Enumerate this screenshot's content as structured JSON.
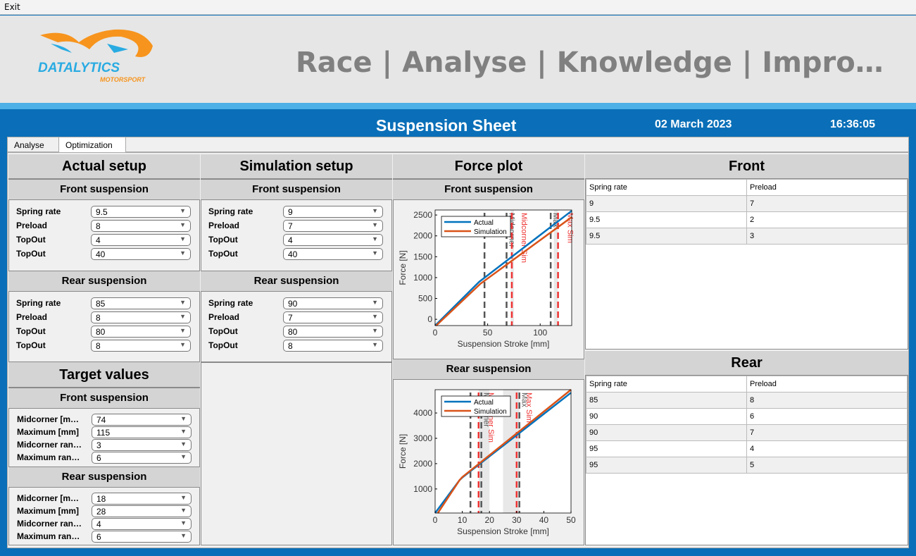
{
  "menu": {
    "exit": "Exit"
  },
  "banner": {
    "logo_text": "DATALYTICS",
    "logo_sub": "MOTORSPORT",
    "slogan": "Race | Analyse | Knowledge | Impro…"
  },
  "header": {
    "title": "Suspension Sheet",
    "date": "02 March 2023",
    "time": "16:36:05"
  },
  "tabs": [
    {
      "label": "Analyse"
    },
    {
      "label": "Optimization"
    }
  ],
  "actual": {
    "title": "Actual setup",
    "front": {
      "title": "Front suspension",
      "rows": [
        {
          "label": "Spring rate",
          "value": "9.5"
        },
        {
          "label": "Preload",
          "value": "8"
        },
        {
          "label": "TopOut",
          "value": "4"
        },
        {
          "label": "TopOut",
          "value": "40"
        }
      ]
    },
    "rear": {
      "title": "Rear suspension",
      "rows": [
        {
          "label": "Spring rate",
          "value": "85"
        },
        {
          "label": "Preload",
          "value": "8"
        },
        {
          "label": "TopOut",
          "value": "80"
        },
        {
          "label": "TopOut",
          "value": "8"
        }
      ]
    }
  },
  "simulation": {
    "title": "Simulation setup",
    "front": {
      "title": "Front suspension",
      "rows": [
        {
          "label": "Spring rate",
          "value": "9"
        },
        {
          "label": "Preload",
          "value": "7"
        },
        {
          "label": "TopOut",
          "value": "4"
        },
        {
          "label": "TopOut",
          "value": "40"
        }
      ]
    },
    "rear": {
      "title": "Rear suspension",
      "rows": [
        {
          "label": "Spring rate",
          "value": "90"
        },
        {
          "label": "Preload",
          "value": "7"
        },
        {
          "label": "TopOut",
          "value": "80"
        },
        {
          "label": "TopOut",
          "value": "8"
        }
      ]
    }
  },
  "target": {
    "title": "Target values",
    "front": {
      "title": "Front suspension",
      "rows": [
        {
          "label": "Midcorner [m…",
          "value": "74"
        },
        {
          "label": "Maximum [mm]",
          "value": "115"
        },
        {
          "label": "Midcorner ran…",
          "value": "3"
        },
        {
          "label": "Maximum ran…",
          "value": "6"
        }
      ]
    },
    "rear": {
      "title": "Rear suspension",
      "rows": [
        {
          "label": "Midcorner [m…",
          "value": "18"
        },
        {
          "label": "Maximum [mm]",
          "value": "28"
        },
        {
          "label": "Midcorner ran…",
          "value": "4"
        },
        {
          "label": "Maximum ran…",
          "value": "6"
        }
      ]
    }
  },
  "force_plot": {
    "title": "Force plot",
    "front_title": "Front suspension",
    "rear_title": "Rear suspension"
  },
  "chart_data": [
    {
      "type": "line",
      "title": "Front suspension",
      "xlabel": "Suspension Stroke [mm]",
      "ylabel": "Force [N]",
      "xlim": [
        0,
        130
      ],
      "ylim": [
        -150,
        2620
      ],
      "xticks": [
        0,
        50,
        100
      ],
      "yticks": [
        0,
        500,
        1000,
        1500,
        2000,
        2500
      ],
      "legend": "top-left",
      "series": [
        {
          "name": "Actual",
          "color": "#0072bd",
          "points": [
            [
              0,
              -150
            ],
            [
              42,
              900
            ],
            [
              130,
              2600
            ]
          ]
        },
        {
          "name": "Simulation",
          "color": "#d95319",
          "points": [
            [
              1,
              -150
            ],
            [
              43,
              850
            ],
            [
              130,
              2450
            ]
          ]
        }
      ],
      "bands": [
        [
          72,
          75
        ],
        [
          113,
          117
        ]
      ],
      "vlines": [
        {
          "x": 47,
          "color": "#555555",
          "label": ""
        },
        {
          "x": 68,
          "color": "#555555",
          "label": "Midcorner"
        },
        {
          "x": 73,
          "color": "#ee3333",
          "label": "Midcorner Sim"
        },
        {
          "x": 110,
          "color": "#555555",
          "label": "Max"
        },
        {
          "x": 117,
          "color": "#ee3333",
          "label": "Max Sim"
        }
      ]
    },
    {
      "type": "line",
      "title": "Rear suspension",
      "xlabel": "Suspension Stroke [mm]",
      "ylabel": "Force [N]",
      "xlim": [
        0,
        50
      ],
      "ylim": [
        50,
        4920
      ],
      "xticks": [
        0,
        10,
        20,
        30,
        40,
        50
      ],
      "yticks": [
        1000,
        2000,
        3000,
        4000
      ],
      "legend": "top-left",
      "series": [
        {
          "name": "Actual",
          "color": "#0072bd",
          "points": [
            [
              0,
              0
            ],
            [
              9,
              1350
            ],
            [
              10,
              1450
            ],
            [
              50,
              4800
            ]
          ]
        },
        {
          "name": "Simulation",
          "color": "#d95319",
          "points": [
            [
              1,
              0
            ],
            [
              9,
              1350
            ],
            [
              10,
              1470
            ],
            [
              50,
              4920
            ]
          ]
        }
      ],
      "bands": [
        [
          16,
          20
        ],
        [
          25,
          31
        ]
      ],
      "vlines": [
        {
          "x": 13,
          "color": "#555555",
          "label": ""
        },
        {
          "x": 16,
          "color": "#ee3333",
          "label": "Midcorner Sim"
        },
        {
          "x": 17,
          "color": "#555555",
          "label": "Midcorner"
        },
        {
          "x": 30,
          "color": "#ee3333",
          "label": "Max Sim"
        },
        {
          "x": 31,
          "color": "#555555",
          "label": "Max"
        }
      ]
    }
  ],
  "front_table": {
    "title": "Front",
    "columns": [
      "Spring rate",
      "Preload"
    ],
    "rows": [
      [
        "9",
        "7"
      ],
      [
        "9.5",
        "2"
      ],
      [
        "9.5",
        "3"
      ]
    ]
  },
  "rear_table": {
    "title": "Rear",
    "columns": [
      "Spring rate",
      "Preload"
    ],
    "rows": [
      [
        "85",
        "8"
      ],
      [
        "90",
        "6"
      ],
      [
        "90",
        "7"
      ],
      [
        "95",
        "4"
      ],
      [
        "95",
        "5"
      ]
    ]
  }
}
